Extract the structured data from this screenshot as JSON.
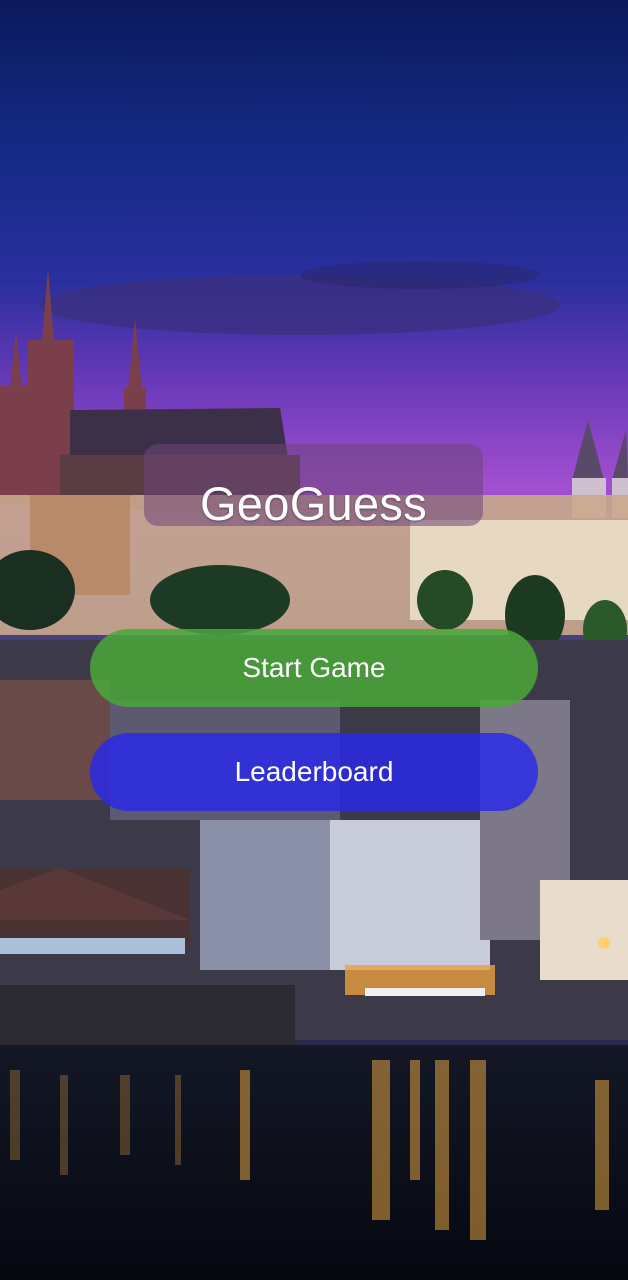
{
  "app": {
    "title": "GeoGuess"
  },
  "buttons": {
    "start_label": "Start Game",
    "leaderboard_label": "Leaderboard"
  },
  "colors": {
    "start_button": "#4aa838",
    "leaderboard_button": "#2828eb",
    "sky_top": "#0e1f63",
    "sky_dusk": "#a24fd0",
    "water": "#0a1020"
  },
  "background": {
    "image": "night-city-castle-riverside"
  }
}
